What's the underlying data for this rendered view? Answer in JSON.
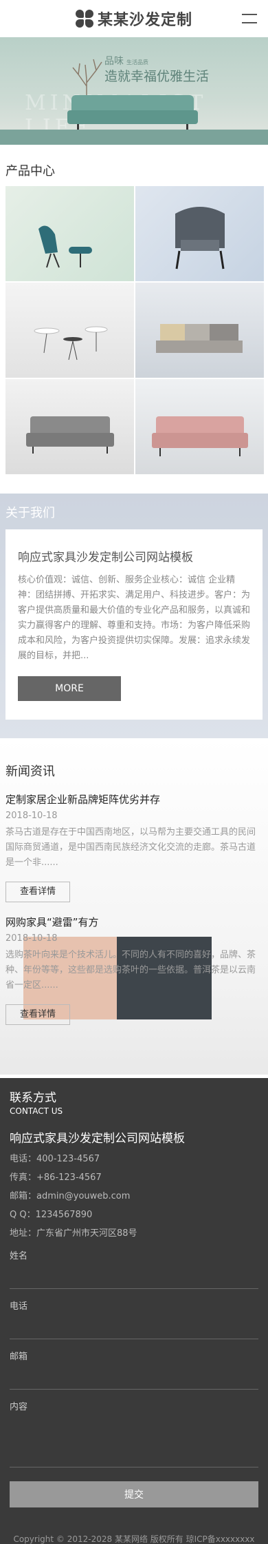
{
  "header": {
    "logo_text": "某某沙发定制",
    "menu_icon": "hamburger-menu-icon"
  },
  "banner": {
    "title_small": "品味",
    "title_tag": "生活品质",
    "title_main": "造就幸福优雅生活",
    "watermark": "MINIMALIST LIFE"
  },
  "products": {
    "title": "产品中心"
  },
  "about": {
    "title": "关于我们",
    "card_title": "响应式家具沙发定制公司网站模板",
    "text": "核心价值观：诚信、创新、服务企业核心：诚信 企业精神：团结拼搏、开拓求实、满足用户、科技进步。客户：为客户提供高质量和最大价值的专业化产品和服务，以真诚和实力赢得客户的理解、尊重和支持。市场：为客户降低采购成本和风险，为客户投资提供切实保障。发展：追求永续发展的目标，并把...",
    "more_label": "MORE"
  },
  "news": {
    "title": "新闻资讯",
    "items": [
      {
        "title": "定制家居企业新品牌矩阵优劣并存",
        "date": "2018-10-18",
        "desc": "茶马古道是存在于中国西南地区，以马帮为主要交通工具的民间国际商贸通道，是中国西南民族经济文化交流的走廊。茶马古道是一个非......",
        "button": "查看详情"
      },
      {
        "title": "网购家具“避雷”有方",
        "date": "2018-10-18",
        "desc": "选购茶叶向来是个技术活儿。不同的人有不同的喜好，品牌、茶种、年份等等，这些都是选购茶叶的一些依据。普洱茶是以云南省一定区......",
        "button": "查看详情"
      }
    ]
  },
  "footer": {
    "title": "联系方式",
    "subtitle": "CONTACT US",
    "company": "响应式家具沙发定制公司网站模板",
    "contacts": [
      {
        "label": "电话：",
        "value": "400-123-4567"
      },
      {
        "label": "传真：",
        "value": "+86-123-4567"
      },
      {
        "label": "邮箱：",
        "value": "admin@youweb.com"
      },
      {
        "label": "Q Q：",
        "value": "1234567890"
      },
      {
        "label": "地址：",
        "value": "广东省广州市天河区88号"
      }
    ],
    "form": {
      "name_label": "姓名",
      "phone_label": "电话",
      "email_label": "邮箱",
      "content_label": "内容",
      "submit_label": "提交"
    },
    "copyright": "Copyright © 2012-2028 某某网络 版权所有  琼ICP备xxxxxxxx号"
  }
}
